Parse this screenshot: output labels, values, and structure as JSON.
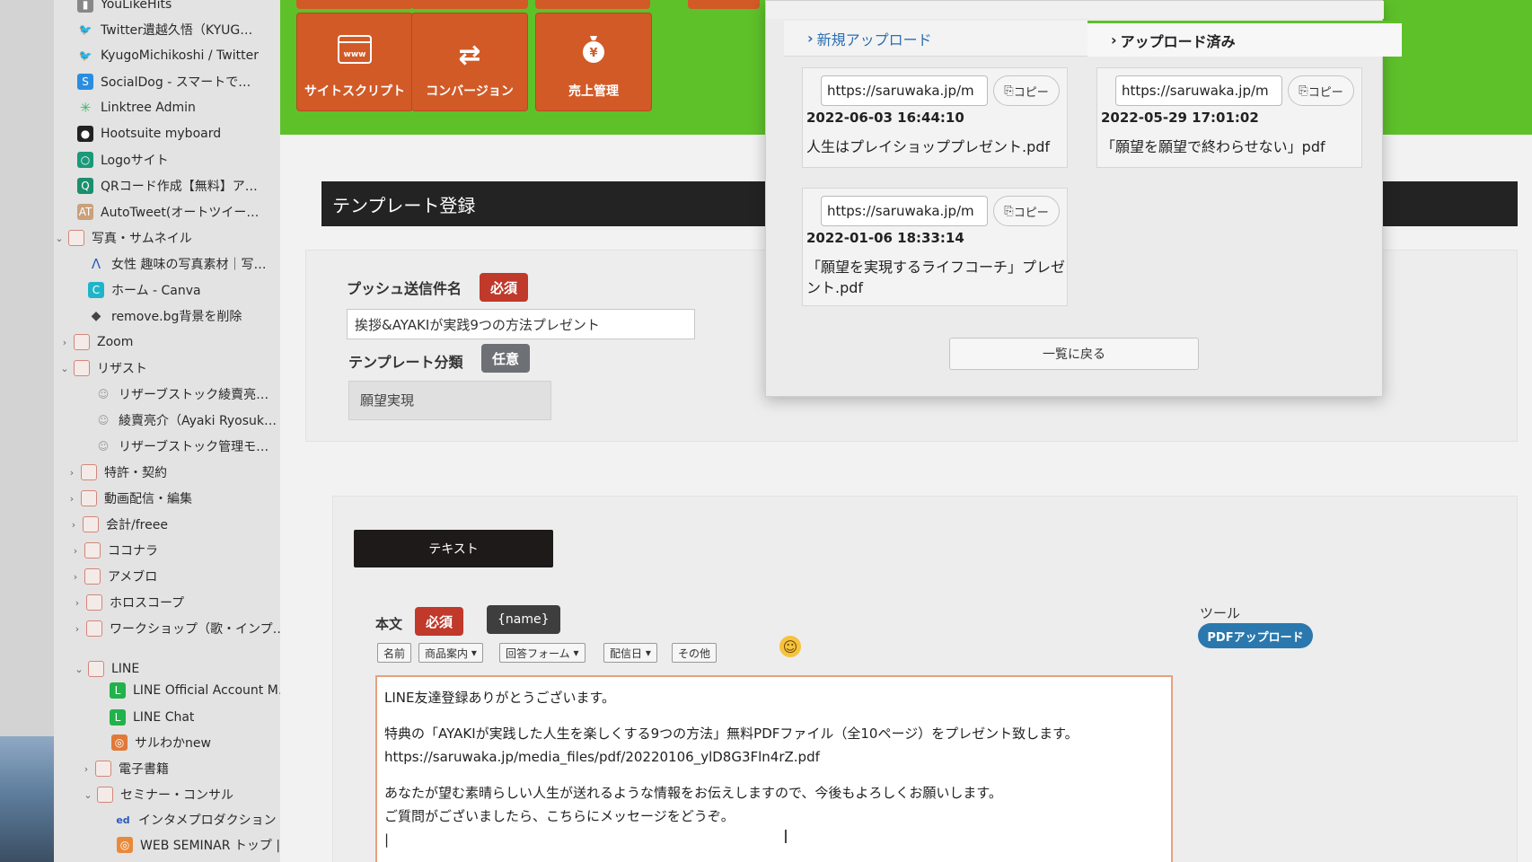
{
  "sidebar": {
    "items": [
      {
        "label": "YouLikeHits",
        "icon": "bookmark-icon"
      },
      {
        "label": "Twitter遺越久悟（KYUG…",
        "icon": "twitter-icon"
      },
      {
        "label": "KyugoMichikoshi / Twitter",
        "icon": "twitter-icon"
      },
      {
        "label": "SocialDog - スマートで…",
        "icon": "socialdog-icon"
      },
      {
        "label": "Linktree Admin",
        "icon": "linktree-icon"
      },
      {
        "label": "Hootsuite myboard",
        "icon": "hootsuite-icon"
      },
      {
        "label": "Logoサイト",
        "icon": "logo-site-icon"
      },
      {
        "label": "QRコード作成【無料】ア…",
        "icon": "qr-icon"
      },
      {
        "label": "AutoTweet(オートツイー…",
        "icon": "autotweet-icon"
      },
      {
        "label": "写真・サムネイル",
        "icon": "folder-icon"
      },
      {
        "label": "女性 趣味の写真素材｜写…",
        "icon": "photo-site-icon"
      },
      {
        "label": "ホーム - Canva",
        "icon": "canva-icon"
      },
      {
        "label": "remove.bg背景を削除",
        "icon": "removebg-icon"
      },
      {
        "label": "Zoom",
        "icon": "folder-icon"
      },
      {
        "label": "リザスト",
        "icon": "folder-icon"
      },
      {
        "label": "リザーブストック綾賣亮…",
        "icon": "reservestock-icon"
      },
      {
        "label": "綾賣亮介（Ayaki Ryosuk…",
        "icon": "reservestock-icon"
      },
      {
        "label": "リザーブストック管理モ…",
        "icon": "reservestock-icon"
      },
      {
        "label": "特許・契約",
        "icon": "folder-icon"
      },
      {
        "label": "動画配信・編集",
        "icon": "folder-icon"
      },
      {
        "label": "会計/freee",
        "icon": "folder-icon"
      },
      {
        "label": "ココナラ",
        "icon": "folder-icon"
      },
      {
        "label": "アメブロ",
        "icon": "folder-icon"
      },
      {
        "label": "ホロスコープ",
        "icon": "folder-icon"
      },
      {
        "label": "ワークショップ（歌・インプ…",
        "icon": "folder-icon"
      },
      {
        "label": "LINE",
        "icon": "folder-icon"
      },
      {
        "label": "LINE Official Account M…",
        "icon": "line-icon"
      },
      {
        "label": "LINE Chat",
        "icon": "line-icon"
      },
      {
        "label": "サルわかnew",
        "icon": "saruwaka-icon"
      },
      {
        "label": "電子書籍",
        "icon": "folder-icon"
      },
      {
        "label": "セミナー・コンサル",
        "icon": "folder-icon"
      },
      {
        "label": "インタメプロダクション",
        "icon": "ed-icon"
      },
      {
        "label": "WEB SEMINAR トップ |…",
        "icon": "web-seminar-icon"
      }
    ]
  },
  "toolbar": {
    "site_script": "サイトスクリプト",
    "conversion": "コンバージョン",
    "sales": "売上管理"
  },
  "template": {
    "header": "テンプレート登録",
    "push_label": "プッシュ送信件名",
    "required": "必須",
    "optional": "任意",
    "push_value": "挨拶&AYAKIが実践9つの方法プレゼント",
    "category_label": "テンプレート分類",
    "category_value": "願望実現",
    "text_tab": "テキスト",
    "body_label": "本文",
    "name_tag": "{name}",
    "insert_buttons": {
      "name": "名前",
      "product": "商品案内",
      "answer_form": "回答フォーム",
      "delivery_date": "配信日",
      "other": "その他"
    },
    "tools_label": "ツール",
    "pdf_upload": "PDFアップロード",
    "body_lines": {
      "l1": "LINE友達登録ありがとうございます。",
      "l2": "特典の「AYAKIが実践した人生を楽しくする9つの方法」無料PDFファイル（全10ページ）をプレゼント致します。",
      "l3": "https://saruwaka.jp/media_files/pdf/20220106_ylD8G3Fln4rZ.pdf",
      "l4": "あなたが望む素晴らしい人生が送れるような情報をお伝えしますので、今後もよろしくお願いします。",
      "l5": "ご質問がございましたら、こちらにメッセージをどうぞ。"
    }
  },
  "popup": {
    "tab_new": "新規アップロード",
    "tab_uploaded": "アップロード済み",
    "copy_label": "コピー",
    "back_label": "一覧に戻る",
    "files": [
      {
        "url": "https://saruwaka.jp/m",
        "date": "2022-06-03 16:44:10",
        "name": "人生はプレイショッププレゼント.pdf"
      },
      {
        "url": "https://saruwaka.jp/m",
        "date": "2022-05-29 17:01:02",
        "name": "「願望を願望で終わらせない」pdf"
      },
      {
        "url": "https://saruwaka.jp/m",
        "date": "2022-01-06 18:33:14",
        "name": "「願望を実現するライフコーチ」プレゼント.pdf"
      }
    ]
  },
  "colors": {
    "green_bar": "#5ec12a",
    "tool_button": "#d25a27",
    "required_badge": "#c0392b",
    "pdf_button": "#2a78ad"
  }
}
